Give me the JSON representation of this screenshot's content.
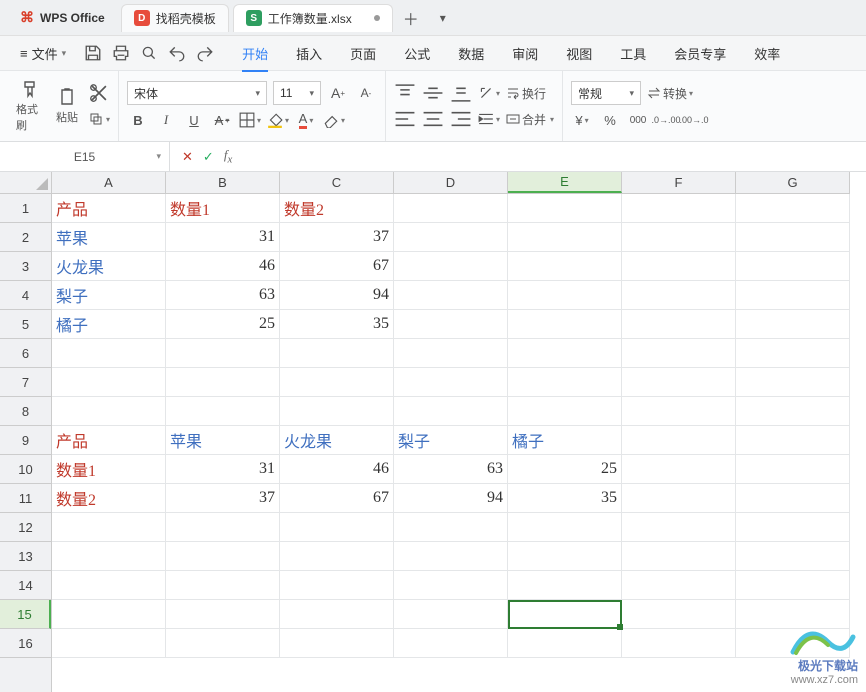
{
  "tabs": {
    "app_name": "WPS Office",
    "doke": "找稻壳模板",
    "file": "工作簿数量.xlsx"
  },
  "menubar": {
    "file": "文件",
    "items": [
      "开始",
      "插入",
      "页面",
      "公式",
      "数据",
      "审阅",
      "视图",
      "工具",
      "会员专享",
      "效率"
    ],
    "active_index": 0
  },
  "ribbon": {
    "format_painter": "格式刷",
    "paste": "粘贴",
    "font_name": "宋体",
    "font_size": "11",
    "autowrap": "换行",
    "merge": "合并",
    "number_format": "常规",
    "convert": "转换"
  },
  "namebox": "E15",
  "chart_data": {
    "type": "table",
    "columns": [
      "A",
      "B",
      "C",
      "D",
      "E",
      "F",
      "G"
    ],
    "rows_visible": 16,
    "selected_cell": "E15",
    "selected_col_index": 4,
    "selected_row_index": 14,
    "data": {
      "1": {
        "A": {
          "v": "产品",
          "cls": "txt-red"
        },
        "B": {
          "v": "数量1",
          "cls": "txt-red"
        },
        "C": {
          "v": "数量2",
          "cls": "txt-red"
        }
      },
      "2": {
        "A": {
          "v": "苹果",
          "cls": "txt-blue"
        },
        "B": {
          "v": "31",
          "align": "right"
        },
        "C": {
          "v": "37",
          "align": "right"
        }
      },
      "3": {
        "A": {
          "v": "火龙果",
          "cls": "txt-blue"
        },
        "B": {
          "v": "46",
          "align": "right"
        },
        "C": {
          "v": "67",
          "align": "right"
        }
      },
      "4": {
        "A": {
          "v": "梨子",
          "cls": "txt-blue"
        },
        "B": {
          "v": "63",
          "align": "right"
        },
        "C": {
          "v": "94",
          "align": "right"
        }
      },
      "5": {
        "A": {
          "v": "橘子",
          "cls": "txt-blue"
        },
        "B": {
          "v": "25",
          "align": "right"
        },
        "C": {
          "v": "35",
          "align": "right"
        }
      },
      "9": {
        "A": {
          "v": "产品",
          "cls": "txt-red"
        },
        "B": {
          "v": "苹果",
          "cls": "txt-blue"
        },
        "C": {
          "v": "火龙果",
          "cls": "txt-blue"
        },
        "D": {
          "v": "梨子",
          "cls": "txt-blue"
        },
        "E": {
          "v": "橘子",
          "cls": "txt-blue"
        }
      },
      "10": {
        "A": {
          "v": "数量1",
          "cls": "txt-red"
        },
        "B": {
          "v": "31",
          "align": "right"
        },
        "C": {
          "v": "46",
          "align": "right"
        },
        "D": {
          "v": "63",
          "align": "right"
        },
        "E": {
          "v": "25",
          "align": "right"
        }
      },
      "11": {
        "A": {
          "v": "数量2",
          "cls": "txt-red"
        },
        "B": {
          "v": "37",
          "align": "right"
        },
        "C": {
          "v": "67",
          "align": "right"
        },
        "D": {
          "v": "94",
          "align": "right"
        },
        "E": {
          "v": "35",
          "align": "right"
        }
      }
    }
  },
  "watermark": {
    "brand": "极光下载站",
    "url": "www.xz7.com"
  }
}
